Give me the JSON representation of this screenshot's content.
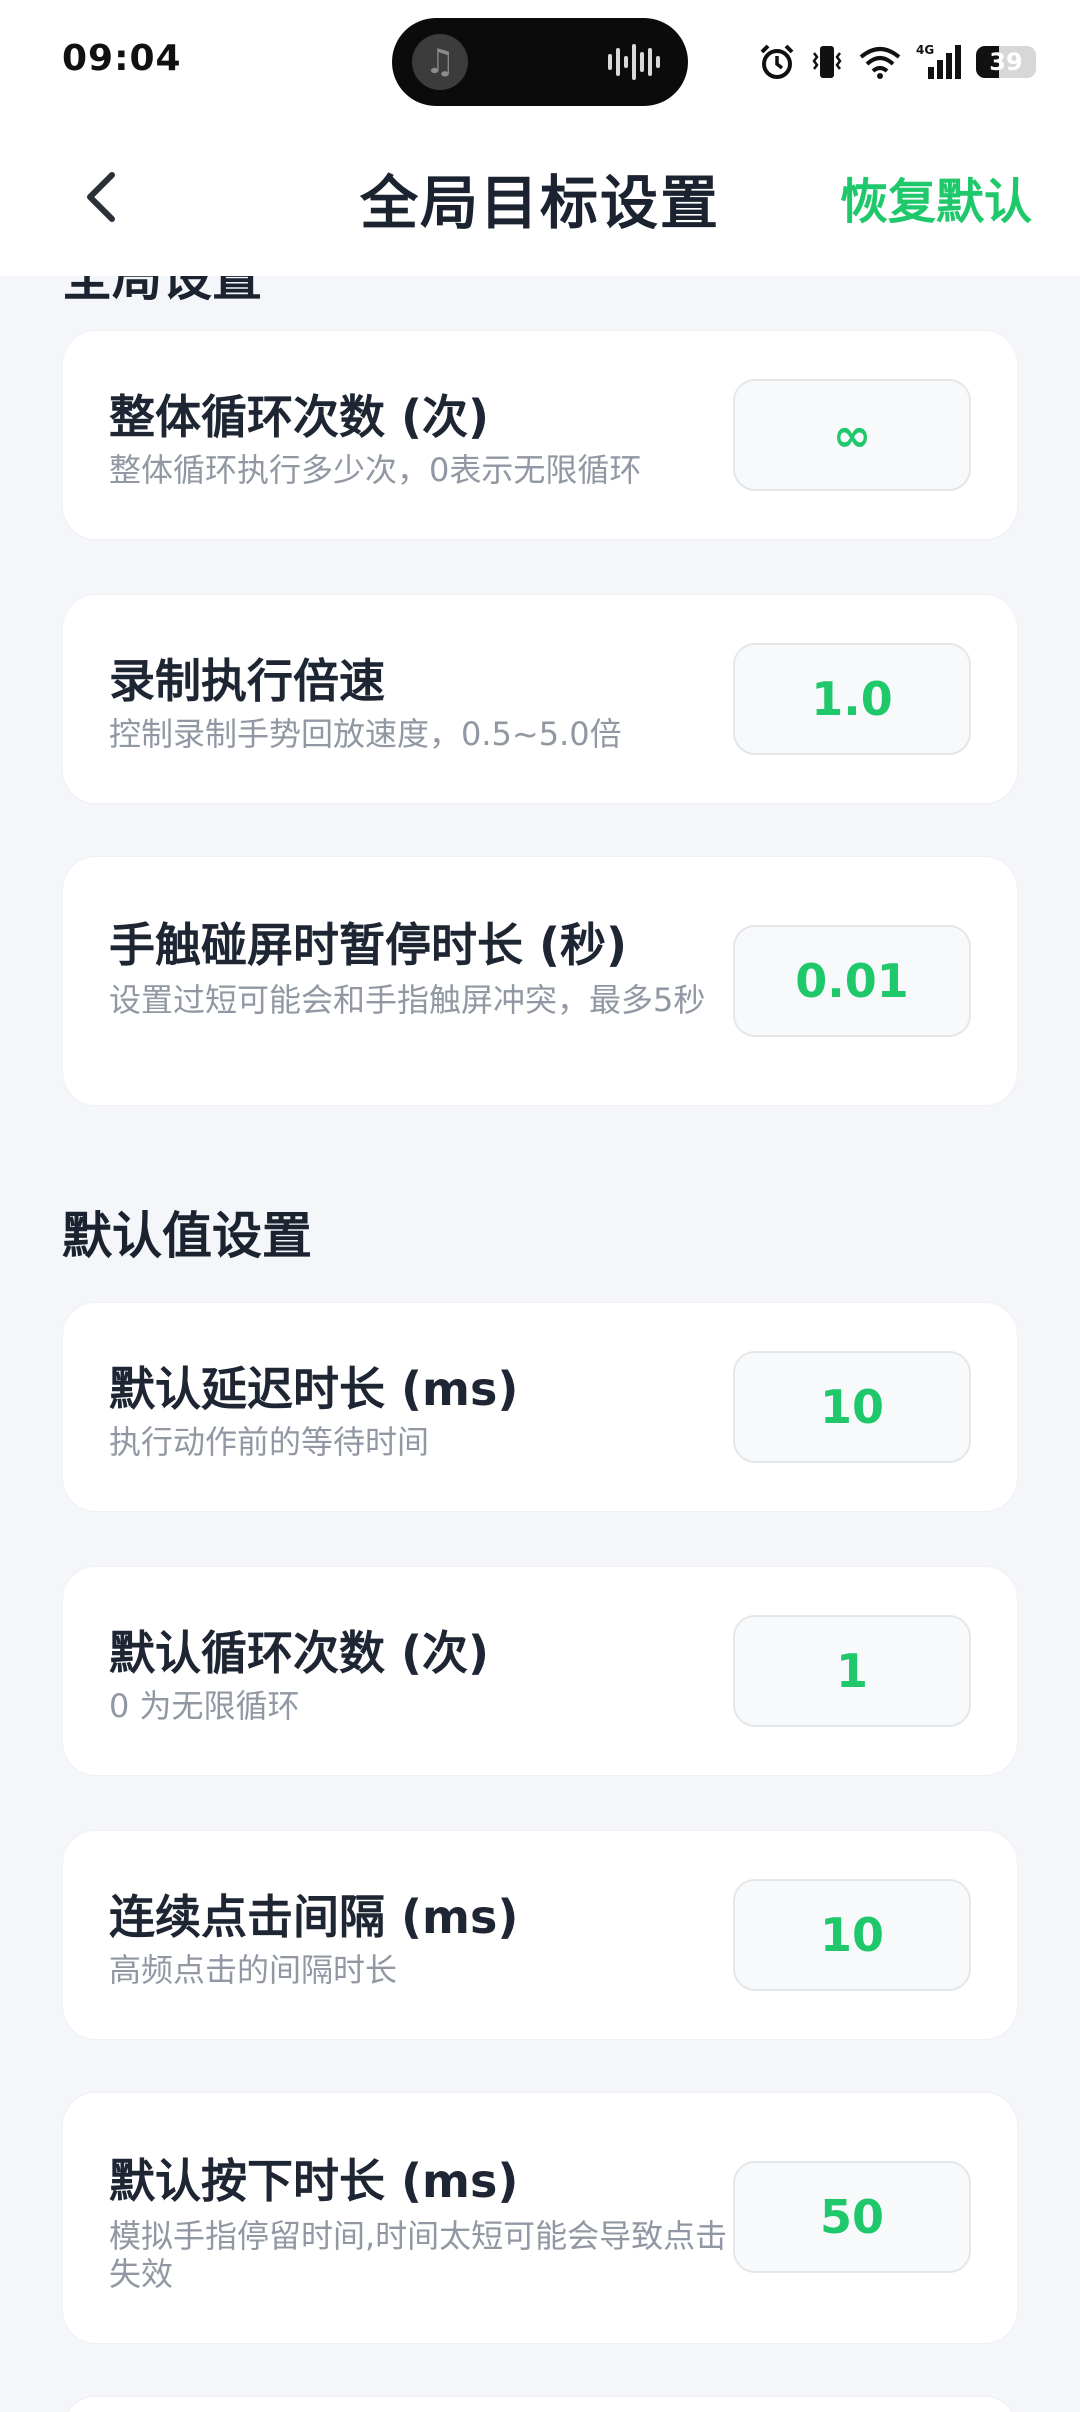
{
  "status_bar": {
    "time": "09:04",
    "battery": 39,
    "network": "4G",
    "icons": [
      "music-icon",
      "voice-wave-icon",
      "alarm-icon",
      "vibrate-icon",
      "wifi-icon",
      "signal-icon",
      "battery-icon"
    ]
  },
  "header": {
    "back_icon": "chevron-left-icon",
    "title": "全局目标设置",
    "reset_label": "恢复默认"
  },
  "colors": {
    "accent": "#1fc96b",
    "background": "#f4f6f9",
    "card": "#ffffff",
    "label": "#1e2533",
    "description": "#9198a3"
  },
  "section_global": {
    "title_partial": "全局设置",
    "items": [
      {
        "label": "整体循环次数 (次)",
        "desc": "整体循环执行多少次，0表示无限循环",
        "value": "∞"
      },
      {
        "label": "录制执行倍速",
        "desc": "控制录制手势回放速度，0.5~5.0倍",
        "value": "1.0"
      },
      {
        "label": "手触碰屏时暂停时长 (秒)",
        "desc": "设置过短可能会和手指触屏冲突，最多5秒",
        "value": "0.01"
      }
    ]
  },
  "section_defaults": {
    "title": "默认值设置",
    "items": [
      {
        "label": "默认延迟时长 (ms)",
        "desc": "执行动作前的等待时间",
        "value": "10"
      },
      {
        "label": "默认循环次数 (次)",
        "desc": "0 为无限循环",
        "value": "1"
      },
      {
        "label": "连续点击间隔 (ms)",
        "desc": "高频点击的间隔时长",
        "value": "10"
      },
      {
        "label": "默认按下时长 (ms)",
        "desc": "模拟手指停留时间,时间太短可能会导致点击失效",
        "value": "50"
      }
    ]
  }
}
